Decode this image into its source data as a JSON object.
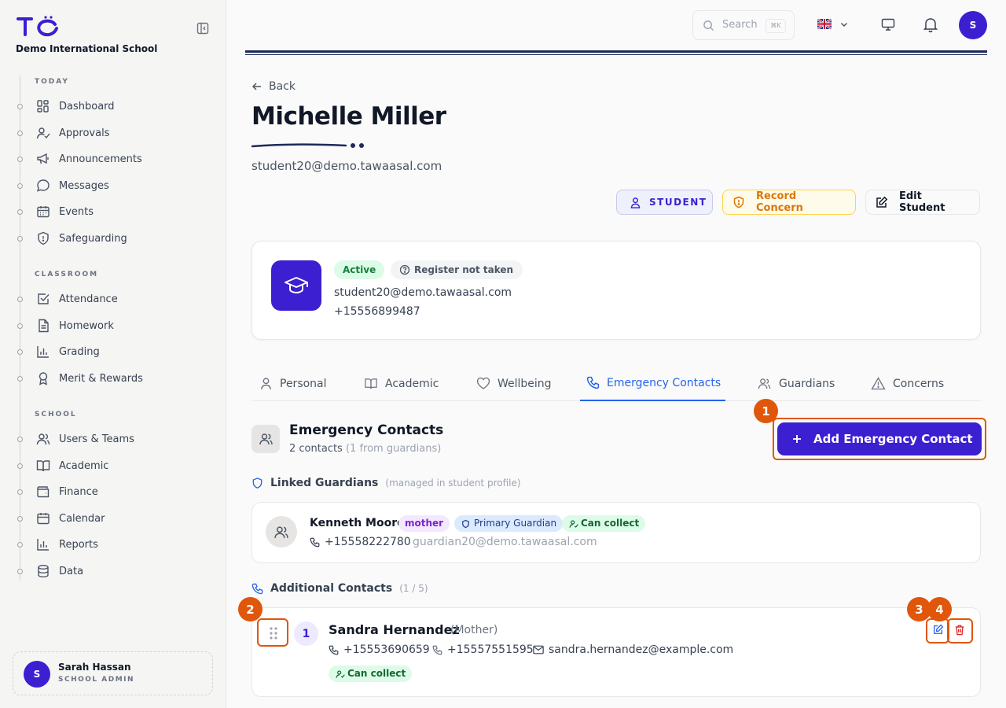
{
  "sidebar": {
    "school_name": "Demo International School",
    "sections": {
      "today": "TODAY",
      "classroom": "CLASSROOM",
      "school": "SCHOOL"
    },
    "items": [
      {
        "label": "Dashboard",
        "icon": "dashboard-icon"
      },
      {
        "label": "Approvals",
        "icon": "user-check-icon"
      },
      {
        "label": "Announcements",
        "icon": "megaphone-icon"
      },
      {
        "label": "Messages",
        "icon": "message-icon"
      },
      {
        "label": "Events",
        "icon": "calendar-icon"
      },
      {
        "label": "Safeguarding",
        "icon": "shield-icon"
      },
      {
        "label": "Attendance",
        "icon": "checkbox-icon"
      },
      {
        "label": "Homework",
        "icon": "file-icon"
      },
      {
        "label": "Grading",
        "icon": "bar-chart-icon"
      },
      {
        "label": "Merit & Rewards",
        "icon": "award-icon"
      },
      {
        "label": "Users & Teams",
        "icon": "users-icon"
      },
      {
        "label": "Academic",
        "icon": "book-icon"
      },
      {
        "label": "Finance",
        "icon": "wallet-icon"
      },
      {
        "label": "Calendar",
        "icon": "calendar-icon"
      },
      {
        "label": "Reports",
        "icon": "bar-chart-icon"
      },
      {
        "label": "Data",
        "icon": "database-icon"
      }
    ],
    "user": {
      "initial": "S",
      "name": "Sarah Hassan",
      "role": "SCHOOL ADMIN"
    }
  },
  "topbar": {
    "search_placeholder": "Search",
    "search_shortcut": "⌘K",
    "avatar_initial": "S"
  },
  "header": {
    "back_label": "Back",
    "title": "Michelle Miller",
    "email": "student20@demo.tawaasal.com",
    "role_button": "STUDENT",
    "concern_button": "Record Concern",
    "edit_button": "Edit Student"
  },
  "profile": {
    "status": "Active",
    "register": "Register not taken",
    "email": "student20@demo.tawaasal.com",
    "phone": "+15556899487"
  },
  "tabs": [
    {
      "label": "Personal",
      "icon": "user-icon"
    },
    {
      "label": "Academic",
      "icon": "book-icon"
    },
    {
      "label": "Wellbeing",
      "icon": "heart-icon"
    },
    {
      "label": "Emergency Contacts",
      "icon": "phone-icon"
    },
    {
      "label": "Guardians",
      "icon": "users-icon"
    },
    {
      "label": "Concerns",
      "icon": "warning-icon"
    }
  ],
  "emergency": {
    "title": "Emergency Contacts",
    "count_text": "2 contacts",
    "count_note": "(1 from guardians)",
    "add_button": "Add Emergency Contact",
    "linked_heading": "Linked Guardians",
    "linked_hint": "(managed in student profile)",
    "guardian": {
      "name": "Kenneth Moore",
      "relation": "mother",
      "primary": "Primary Guardian",
      "collect": "Can collect",
      "phone": "+15558222780",
      "email": "guardian20@demo.tawaasal.com"
    },
    "additional_heading": "Additional Contacts",
    "additional_count": "(1 / 5)",
    "contact": {
      "order": "1",
      "name": "Sandra Hernandez",
      "relation": "(Mother)",
      "phone1": "+15553690659",
      "phone2": "+15557551595",
      "email": "sandra.hernandez@example.com",
      "collect": "Can collect"
    }
  },
  "annotations": [
    "1",
    "2",
    "3",
    "4"
  ],
  "colors": {
    "primary": "#3b1fd1",
    "link": "#2563eb",
    "highlight": "#e0560b"
  }
}
